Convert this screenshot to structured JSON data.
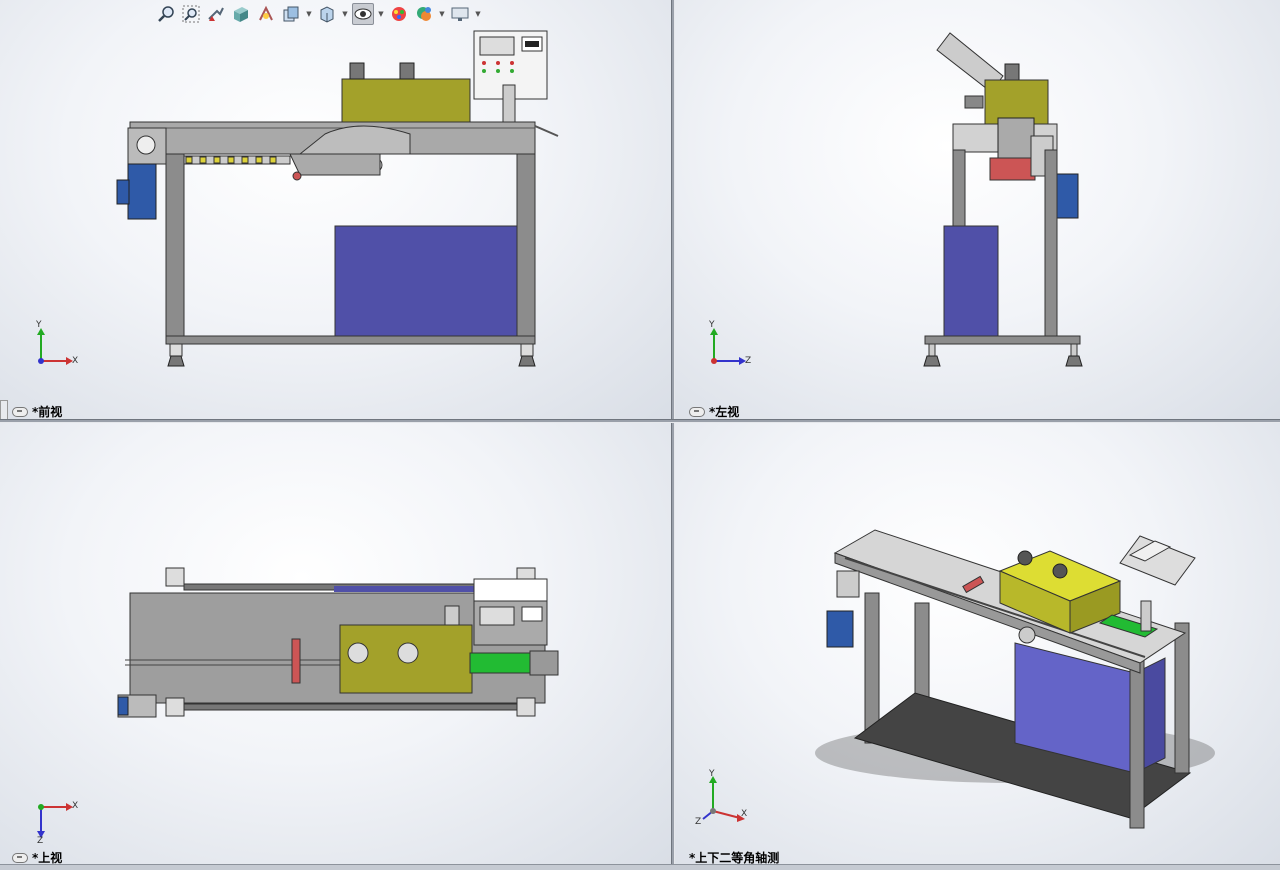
{
  "viewports": {
    "front": {
      "label": "*前视",
      "axes": {
        "up": "Y",
        "right": "X"
      }
    },
    "left": {
      "label": "*左视",
      "axes": {
        "up": "Y",
        "right": "Z"
      }
    },
    "top": {
      "label": "*上视",
      "axes": {
        "down": "Z",
        "right": "X"
      }
    },
    "iso": {
      "label": "*上下二等角轴测",
      "axes": {
        "up": "Y",
        "right": "X",
        "left": "Z"
      }
    }
  },
  "toolbar": {
    "icons": [
      "zoom-to-fit-icon",
      "zoom-to-area-icon",
      "previous-view-icon",
      "section-view-icon",
      "view-orientation-icon",
      "display-style-icon",
      "hide-show-icon",
      "edit-appearance-icon",
      "apply-scene-icon",
      "view-settings-icon"
    ]
  },
  "colors": {
    "frame": "#8c8c8c",
    "olive_box": "#a3a12a",
    "blue_box": "#5050a8",
    "motor_blue": "#2f5aa8",
    "green_part": "#22bb33",
    "panel_white": "#f4f4f4"
  }
}
